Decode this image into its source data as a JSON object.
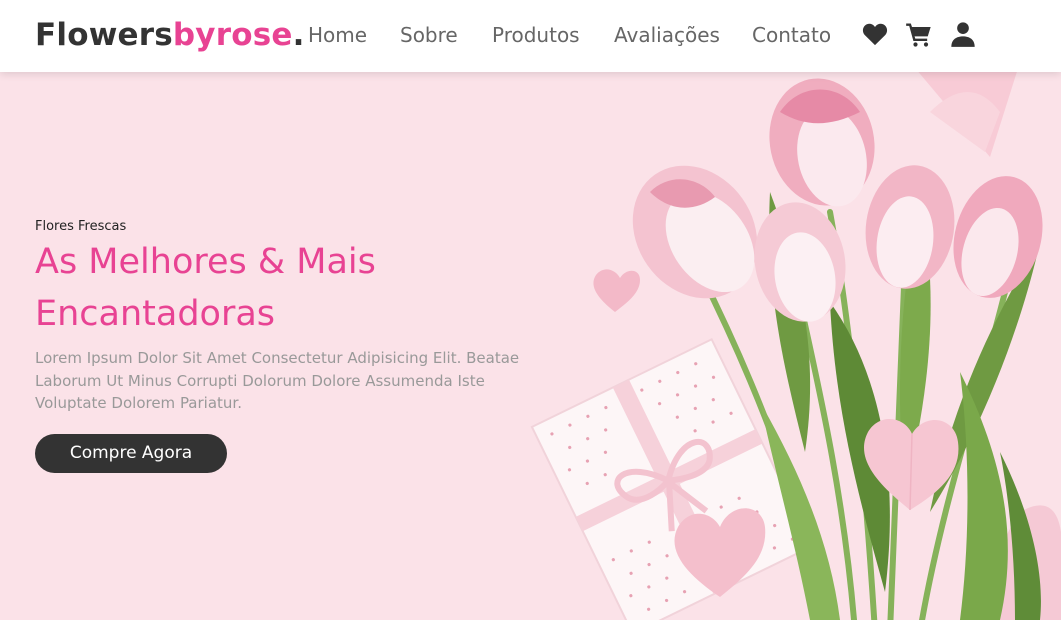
{
  "header": {
    "logo_main": "Flowers",
    "logo_accent": "byrose",
    "logo_dot": ".",
    "nav": [
      "Home",
      "Sobre",
      "Produtos",
      "Avaliações",
      "Contato"
    ],
    "icons": [
      "heart-icon",
      "shopping-cart-icon",
      "user-icon"
    ]
  },
  "hero": {
    "eyebrow": "Flores Frescas",
    "headline_line1": "As Melhores & Mais",
    "headline_line2": "Encantadoras",
    "description": "Lorem Ipsum Dolor Sit Amet Consectetur Adipisicing Elit. Beatae Laborum Ut Minus Corrupti Dolorum Dolore Assumenda Iste Voluptate Dolorem Pariatur.",
    "cta_label": "Compre Agora"
  },
  "colors": {
    "accent": "#e84393",
    "dark": "#333333",
    "background": "#fbe2e8"
  }
}
